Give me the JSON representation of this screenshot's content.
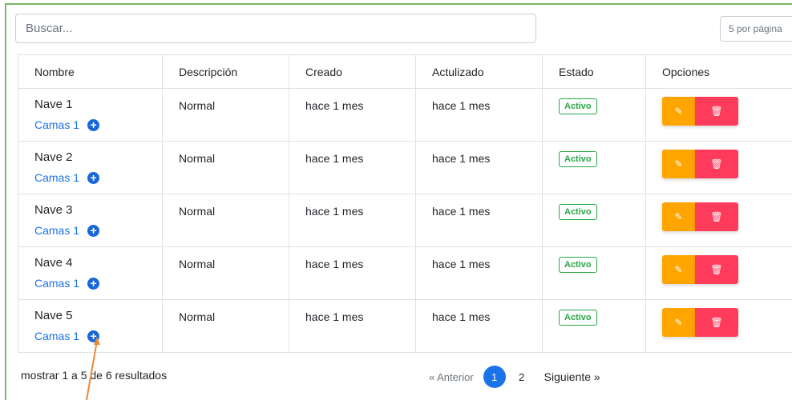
{
  "search": {
    "placeholder": "Buscar..."
  },
  "per_page": {
    "value": "5 por página"
  },
  "table": {
    "headers": [
      "Nombre",
      "Descripción",
      "Creado",
      "Actulizado",
      "Estado",
      "Opciones"
    ],
    "rows": [
      {
        "nombre": "Nave 1",
        "camas": "Camas 1",
        "descripcion": "Normal",
        "creado": "hace 1 mes",
        "actualizado": "hace 1 mes",
        "estado": "Activo"
      },
      {
        "nombre": "Nave 2",
        "camas": "Camas 1",
        "descripcion": "Normal",
        "creado": "hace 1 mes",
        "actualizado": "hace 1 mes",
        "estado": "Activo"
      },
      {
        "nombre": "Nave 3",
        "camas": "Camas 1",
        "descripcion": "Normal",
        "creado": "hace 1 mes",
        "actualizado": "hace 1 mes",
        "estado": "Activo"
      },
      {
        "nombre": "Nave 4",
        "camas": "Camas 1",
        "descripcion": "Normal",
        "creado": "hace 1 mes",
        "actualizado": "hace 1 mes",
        "estado": "Activo"
      },
      {
        "nombre": "Nave 5",
        "camas": "Camas 1",
        "descripcion": "Normal",
        "creado": "hace 1 mes",
        "actualizado": "hace 1 mes",
        "estado": "Activo"
      }
    ]
  },
  "icons": {
    "add": "plus-circle-icon",
    "edit": "pencil-icon",
    "delete": "trash-icon"
  },
  "footer": {
    "info": "mostrar 1 a 5 de 6 resultados",
    "prev": "« Anterior",
    "pages": [
      "1",
      "2"
    ],
    "active_page": "1",
    "next": "Siguiente »"
  },
  "colors": {
    "frame_border": "#7bb662",
    "link": "#1a73e8",
    "active_badge": "#28a745",
    "edit_button": "#ffa500",
    "delete_button": "#ff3b5c",
    "annotation_arrow": "#e8893a"
  }
}
